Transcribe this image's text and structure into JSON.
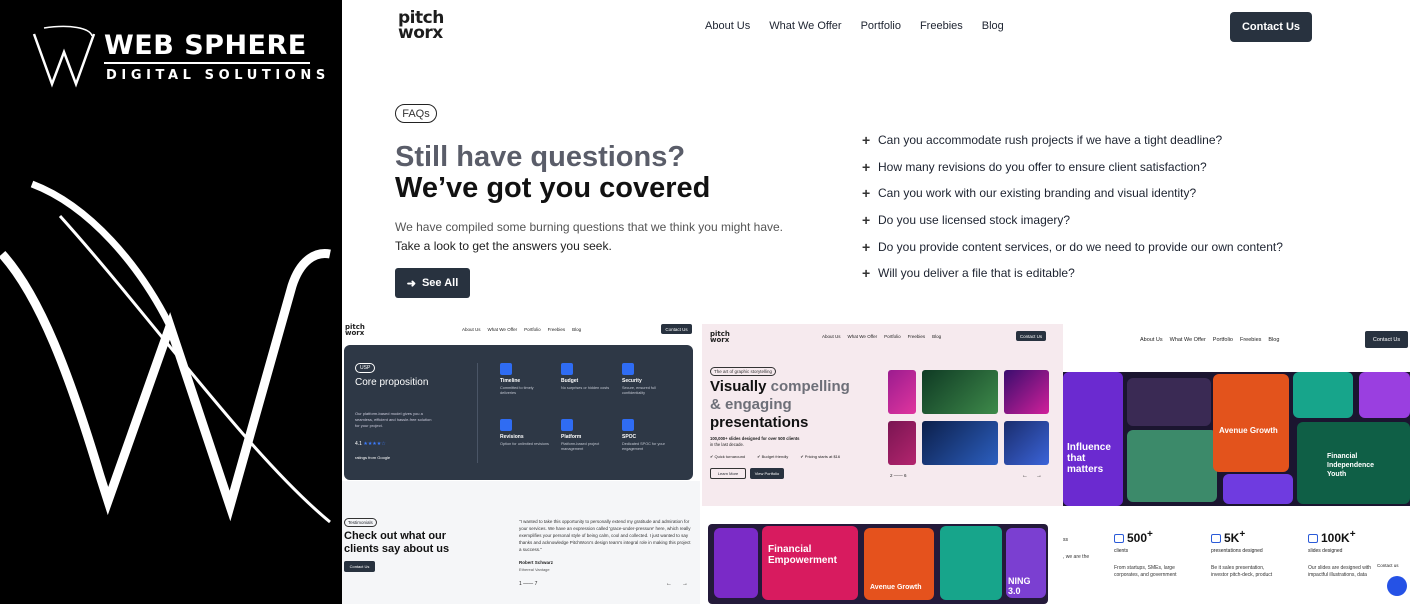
{
  "brand": {
    "name_line1": "WEB SPHERE",
    "name_line2": "DIGITAL SOLUTIONS"
  },
  "header": {
    "logo_line1": "pitch",
    "logo_line2": "worx",
    "nav": [
      "About Us",
      "What We Offer",
      "Portfolio",
      "Freebies",
      "Blog"
    ],
    "contact_label": "Contact Us"
  },
  "faq_section": {
    "pill": "FAQs",
    "title_line1": "Still have questions?",
    "title_line2": "We’ve got you covered",
    "desc_line1": "We have compiled some burning questions that we think you might have.",
    "desc_line2": "Take a look to get the answers you seek.",
    "see_all_label": "See All",
    "questions": [
      "Can you accommodate rush projects if we have a tight deadline?",
      "How many revisions do you offer to ensure client satisfaction?",
      "Can you work with our existing branding and visual identity?",
      "Do you use licensed stock imagery?",
      "Do you provide content services, or do we need to provide our own content?",
      "Will you deliver a file that is editable?"
    ]
  },
  "tile_usp": {
    "pill": "USP",
    "title": "Core proposition",
    "desc": "Our platform-based model gives you a seamless, efficient and hassle-free solution for your project.",
    "rating": "4.1",
    "rating_label": "ratings from Google",
    "features": [
      {
        "title": "Timeline",
        "desc": "Committed to timely deliveries"
      },
      {
        "title": "Budget",
        "desc": "No surprises or hidden costs"
      },
      {
        "title": "Security",
        "desc": "Secure, ensured full confidentiality"
      },
      {
        "title": "Revisions",
        "desc": "Option for unlimited revisions"
      },
      {
        "title": "Platform",
        "desc": "Platform-based project management"
      },
      {
        "title": "SPOC",
        "desc": "Dedicated SPOC for your engagement"
      }
    ]
  },
  "tile_testimonials": {
    "pill": "Testimonials",
    "title": "Check out what our clients say about us",
    "button": "Contact Us",
    "quote": "\"I wanted to take this opportunity to personally extend my gratitude and admiration for your services. We have an expression called 'grace-under-pressure' here, which really exemplifies your personal style of being calm, cool and collected. I just wanted to say thanks and acknowledge PitchWorx's design team's integral role in making this project a success.\"",
    "name": "Robert Schwarz",
    "company": "Ethereal Vantage",
    "page_start": "1",
    "page_end": "7"
  },
  "tile_hero": {
    "pill": "The art of graphic storytelling",
    "title_a": "Visually",
    "title_b": " compelling",
    "title_c": "& engaging",
    "title_d": "presentations",
    "sub_line1": "100,000+ slides designed for over 500 clients",
    "sub_line2": "in the last decade.",
    "checks": [
      "Quick turnaround",
      "Budget friendly",
      "Pricing starts at $16"
    ],
    "learn_more": "Learn More",
    "view_portfolio": "View Portfolio",
    "page_start": "2",
    "page_end": "6"
  },
  "tile_collage": {
    "card_growth": "Avenue Growth",
    "card_influence": "Influence that matters",
    "card_finance": "Financial Independence Youth",
    "card_empower": "Financial Empowerment",
    "card_ning": "NING 3.0"
  },
  "stats": [
    {
      "value": "500",
      "label": "clients",
      "desc": "From startups, SMEs, large corporates, and government"
    },
    {
      "value": "5K",
      "label": "presentations designed",
      "desc": "Be it sales presentation, investor pitch-deck, product"
    },
    {
      "value": "100K",
      "label": "slides designed",
      "desc": "Our slides are designed with impactful illustrations, data"
    }
  ],
  "stats_partial_label": "ss",
  "stats_partial_desc": ", we are the",
  "chat": {
    "label": "Contact us"
  },
  "colors": {
    "accent": "#28323f",
    "brand_bg": "#000000",
    "blue": "#2f6cf3"
  }
}
